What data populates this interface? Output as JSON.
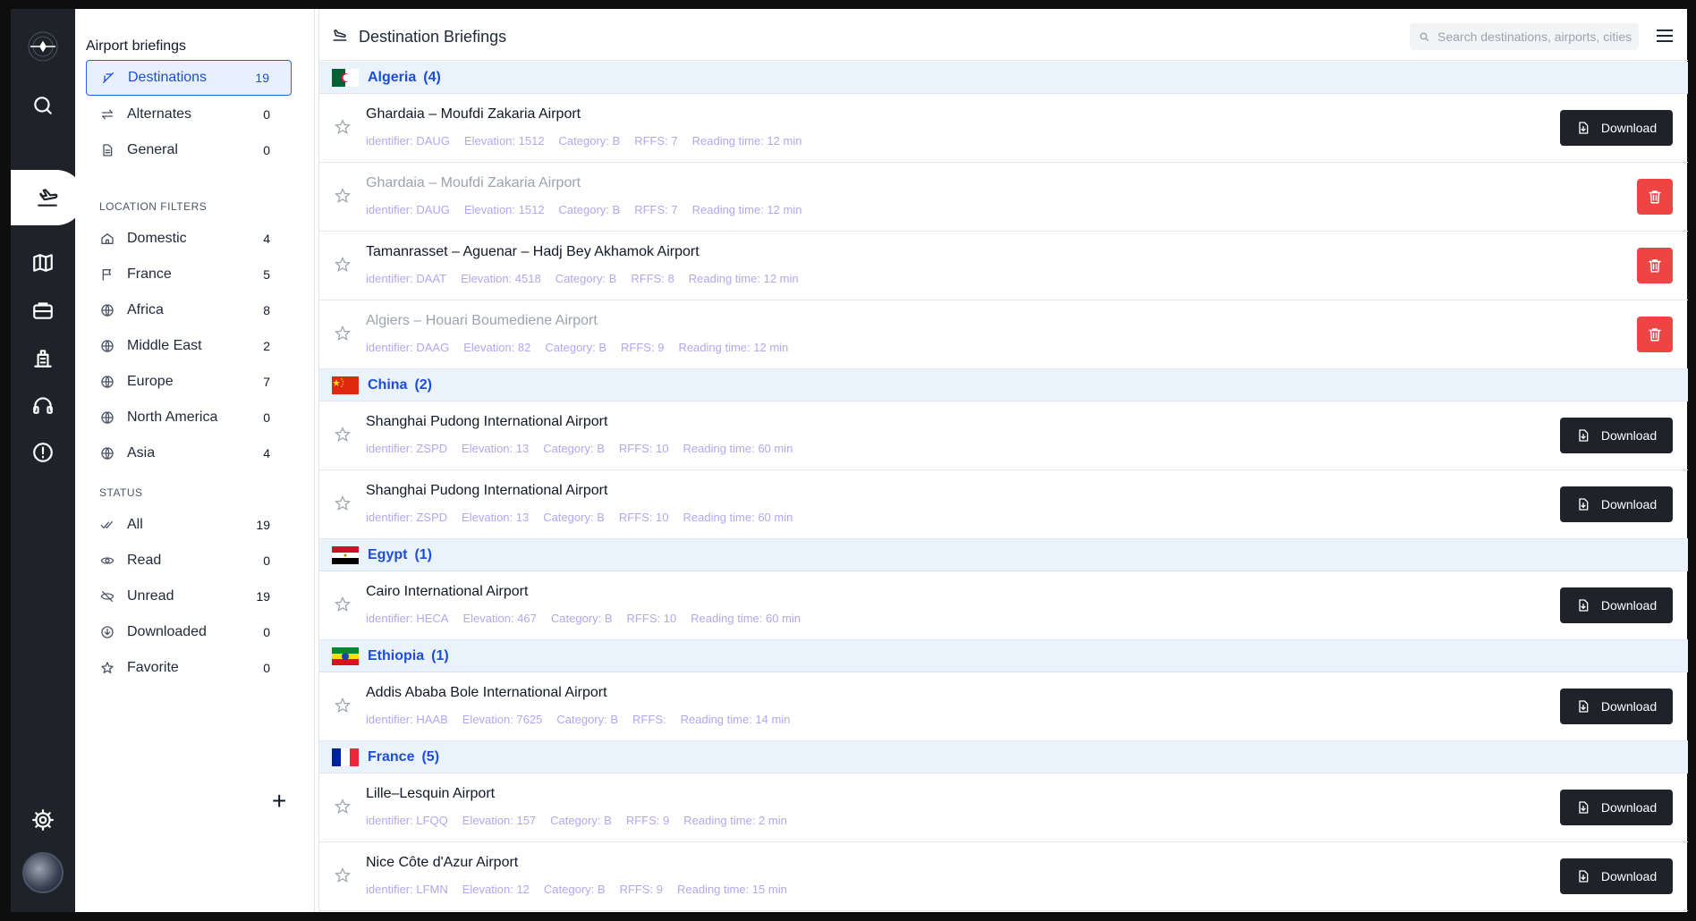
{
  "sidebar": {
    "title": "Airport briefings",
    "nav": [
      {
        "label": "Destinations",
        "count": "19",
        "icon": "plane-icon",
        "active": true
      },
      {
        "label": "Alternates",
        "count": "0",
        "icon": "arrows-swap-icon"
      },
      {
        "label": "General",
        "count": "0",
        "icon": "document-icon"
      }
    ],
    "location_section": "LOCATION FILTERS",
    "locations": [
      {
        "label": "Domestic",
        "count": "4",
        "icon": "home-icon"
      },
      {
        "label": "France",
        "count": "5",
        "icon": "flag-icon"
      },
      {
        "label": "Africa",
        "count": "8",
        "icon": "globe-icon"
      },
      {
        "label": "Middle East",
        "count": "2",
        "icon": "globe-icon"
      },
      {
        "label": "Europe",
        "count": "7",
        "icon": "globe-icon"
      },
      {
        "label": "North America",
        "count": "0",
        "icon": "globe-icon"
      },
      {
        "label": "Asia",
        "count": "4",
        "icon": "globe-icon"
      }
    ],
    "status_section": "STATUS",
    "statuses": [
      {
        "label": "All",
        "count": "19",
        "icon": "double-check-icon"
      },
      {
        "label": "Read",
        "count": "0",
        "icon": "eye-icon"
      },
      {
        "label": "Unread",
        "count": "19",
        "icon": "eye-off-icon"
      },
      {
        "label": "Downloaded",
        "count": "0",
        "icon": "download-circle-icon"
      },
      {
        "label": "Favorite",
        "count": "0",
        "icon": "star-icon"
      }
    ],
    "add_symbol": "+"
  },
  "header": {
    "title": "Destination Briefings",
    "search_placeholder": "Search destinations, airports, cities"
  },
  "groups": [
    {
      "country": "Algeria",
      "count": "(4)",
      "airports": [
        {
          "name": "Ghardaia – Moufdi Zakaria Airport",
          "identifier": "identifier: DAUG",
          "elevation": "Elevation: 1512",
          "category": "Category: B",
          "rffs": "RFFS: 7",
          "reading": "Reading time: 12 min",
          "action": "download",
          "faded": false
        },
        {
          "name": "Ghardaia – Moufdi Zakaria Airport",
          "identifier": "identifier: DAUG",
          "elevation": "Elevation: 1512",
          "category": "Category: B",
          "rffs": "RFFS: 7",
          "reading": "Reading time: 12 min",
          "action": "delete",
          "faded": true
        },
        {
          "name": "Tamanrasset – Aguenar – Hadj Bey Akhamok Airport",
          "identifier": "identifier: DAAT",
          "elevation": "Elevation: 4518",
          "category": "Category: B",
          "rffs": "RFFS: 8",
          "reading": "Reading time: 12 min",
          "action": "delete",
          "faded": false
        },
        {
          "name": "Algiers – Houari Boumediene Airport",
          "identifier": "identifier: DAAG",
          "elevation": "Elevation: 82",
          "category": "Category: B",
          "rffs": "RFFS: 9",
          "reading": "Reading time: 12 min",
          "action": "delete",
          "faded": true
        }
      ]
    },
    {
      "country": "China",
      "count": "(2)",
      "airports": [
        {
          "name": "Shanghai Pudong International Airport",
          "identifier": "identifier: ZSPD",
          "elevation": "Elevation: 13",
          "category": "Category: B",
          "rffs": "RFFS: 10",
          "reading": "Reading time: 60 min",
          "action": "download",
          "faded": false
        },
        {
          "name": "Shanghai Pudong International Airport",
          "identifier": "identifier: ZSPD",
          "elevation": "Elevation: 13",
          "category": "Category: B",
          "rffs": "RFFS: 10",
          "reading": "Reading time: 60 min",
          "action": "download",
          "faded": false
        }
      ]
    },
    {
      "country": "Egypt",
      "count": "(1)",
      "airports": [
        {
          "name": "Cairo International Airport",
          "identifier": "identifier: HECA",
          "elevation": "Elevation: 467",
          "category": "Category: B",
          "rffs": "RFFS: 10",
          "reading": "Reading time: 60 min",
          "action": "download",
          "faded": false
        }
      ]
    },
    {
      "country": "Ethiopia",
      "count": "(1)",
      "airports": [
        {
          "name": "Addis Ababa Bole International Airport",
          "identifier": "identifier: HAAB",
          "elevation": "Elevation: 7625",
          "category": "Category: B",
          "rffs": "RFFS:",
          "reading": "Reading time: 14 min",
          "action": "download",
          "faded": false
        }
      ]
    },
    {
      "country": "France",
      "count": "(5)",
      "airports": [
        {
          "name": "Lille–Lesquin Airport",
          "identifier": "identifier: LFQQ",
          "elevation": "Elevation: 157",
          "category": "Category: B",
          "rffs": "RFFS: 9",
          "reading": "Reading time: 2 min",
          "action": "download",
          "faded": false
        },
        {
          "name": "Nice Côte d'Azur Airport",
          "identifier": "identifier: LFMN",
          "elevation": "Elevation: 12",
          "category": "Category: B",
          "rffs": "RFFS: 9",
          "reading": "Reading time: 15 min",
          "action": "download",
          "faded": false
        }
      ]
    }
  ],
  "download_label": "Download",
  "colors": {
    "accent": "#1d4ed8",
    "rail": "#1f2329",
    "danger": "#ef4444",
    "group_bg": "#eaf2fc",
    "meta": "#b4a6f0"
  }
}
